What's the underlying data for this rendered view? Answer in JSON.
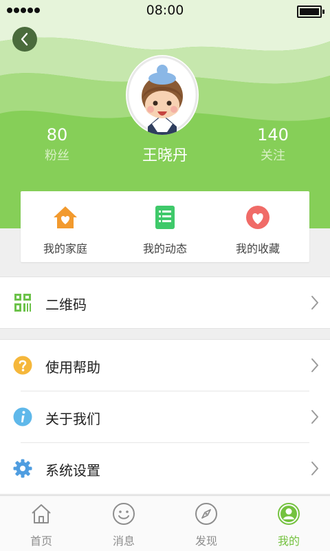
{
  "status_bar": {
    "time": "08:00"
  },
  "profile": {
    "name": "王晓丹",
    "fans": {
      "count": "80",
      "label": "粉丝"
    },
    "following": {
      "count": "140",
      "label": "关注"
    }
  },
  "quick_actions": [
    {
      "label": "我的家庭",
      "icon": "home-heart-icon",
      "color": "#f29a2e"
    },
    {
      "label": "我的动态",
      "icon": "document-list-icon",
      "color": "#3fc96a"
    },
    {
      "label": "我的收藏",
      "icon": "heart-icon",
      "color": "#f06b67"
    }
  ],
  "menu": [
    {
      "label": "二维码",
      "icon": "qrcode-icon",
      "color": "#6cc24a"
    },
    {
      "label": "使用帮助",
      "icon": "help-icon",
      "color": "#f5b73b"
    },
    {
      "label": "关于我们",
      "icon": "info-icon",
      "color": "#5fb8ea"
    },
    {
      "label": "系统设置",
      "icon": "settings-icon",
      "color": "#4f9de0"
    }
  ],
  "tabs": [
    {
      "label": "首页",
      "icon": "home-icon"
    },
    {
      "label": "消息",
      "icon": "message-icon"
    },
    {
      "label": "发现",
      "icon": "compass-icon"
    },
    {
      "label": "我的",
      "icon": "profile-icon",
      "active": true
    }
  ],
  "colors": {
    "brand_green": "#86cf58",
    "tab_active": "#74c23f"
  }
}
